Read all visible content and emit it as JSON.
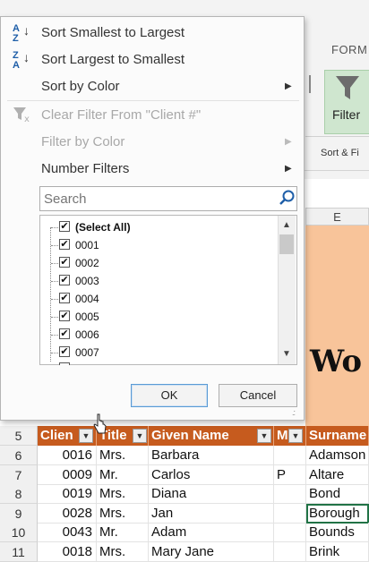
{
  "ribbon": {
    "tab_form": "FORM",
    "filter_label": "Filter",
    "group_label": "Sort & Fi"
  },
  "sheet": {
    "col_e": "E",
    "banner_text": "Wo",
    "header_row_num": "5",
    "headers": [
      "Clien",
      "Title",
      "Given Name",
      "M",
      "Surname"
    ],
    "rows": [
      {
        "num": "6",
        "client": "0016",
        "title": "Mrs.",
        "given": "Barbara",
        "m": "",
        "surname": "Adamson"
      },
      {
        "num": "7",
        "client": "0009",
        "title": "Mr.",
        "given": "Carlos",
        "m": "P",
        "surname": "Altare"
      },
      {
        "num": "8",
        "client": "0019",
        "title": "Mrs.",
        "given": "Diana",
        "m": "",
        "surname": "Bond"
      },
      {
        "num": "9",
        "client": "0028",
        "title": "Mrs.",
        "given": "Jan",
        "m": "",
        "surname": "Borough"
      },
      {
        "num": "10",
        "client": "0043",
        "title": "Mr.",
        "given": "Adam",
        "m": "",
        "surname": "Bounds"
      },
      {
        "num": "11",
        "client": "0018",
        "title": "Mrs.",
        "given": "Mary Jane",
        "m": "",
        "surname": "Brink"
      }
    ]
  },
  "menu": {
    "sort_asc": "Sort Smallest to Largest",
    "sort_desc": "Sort Largest to Smallest",
    "sort_color": "Sort by Color",
    "clear_filter": "Clear Filter From \"Client #\"",
    "filter_color": "Filter by Color",
    "number_filters": "Number Filters",
    "search_placeholder": "Search",
    "select_all": "(Select All)",
    "items": [
      "0001",
      "0002",
      "0003",
      "0004",
      "0005",
      "0006",
      "0007"
    ],
    "ok": "OK",
    "cancel": "Cancel"
  }
}
